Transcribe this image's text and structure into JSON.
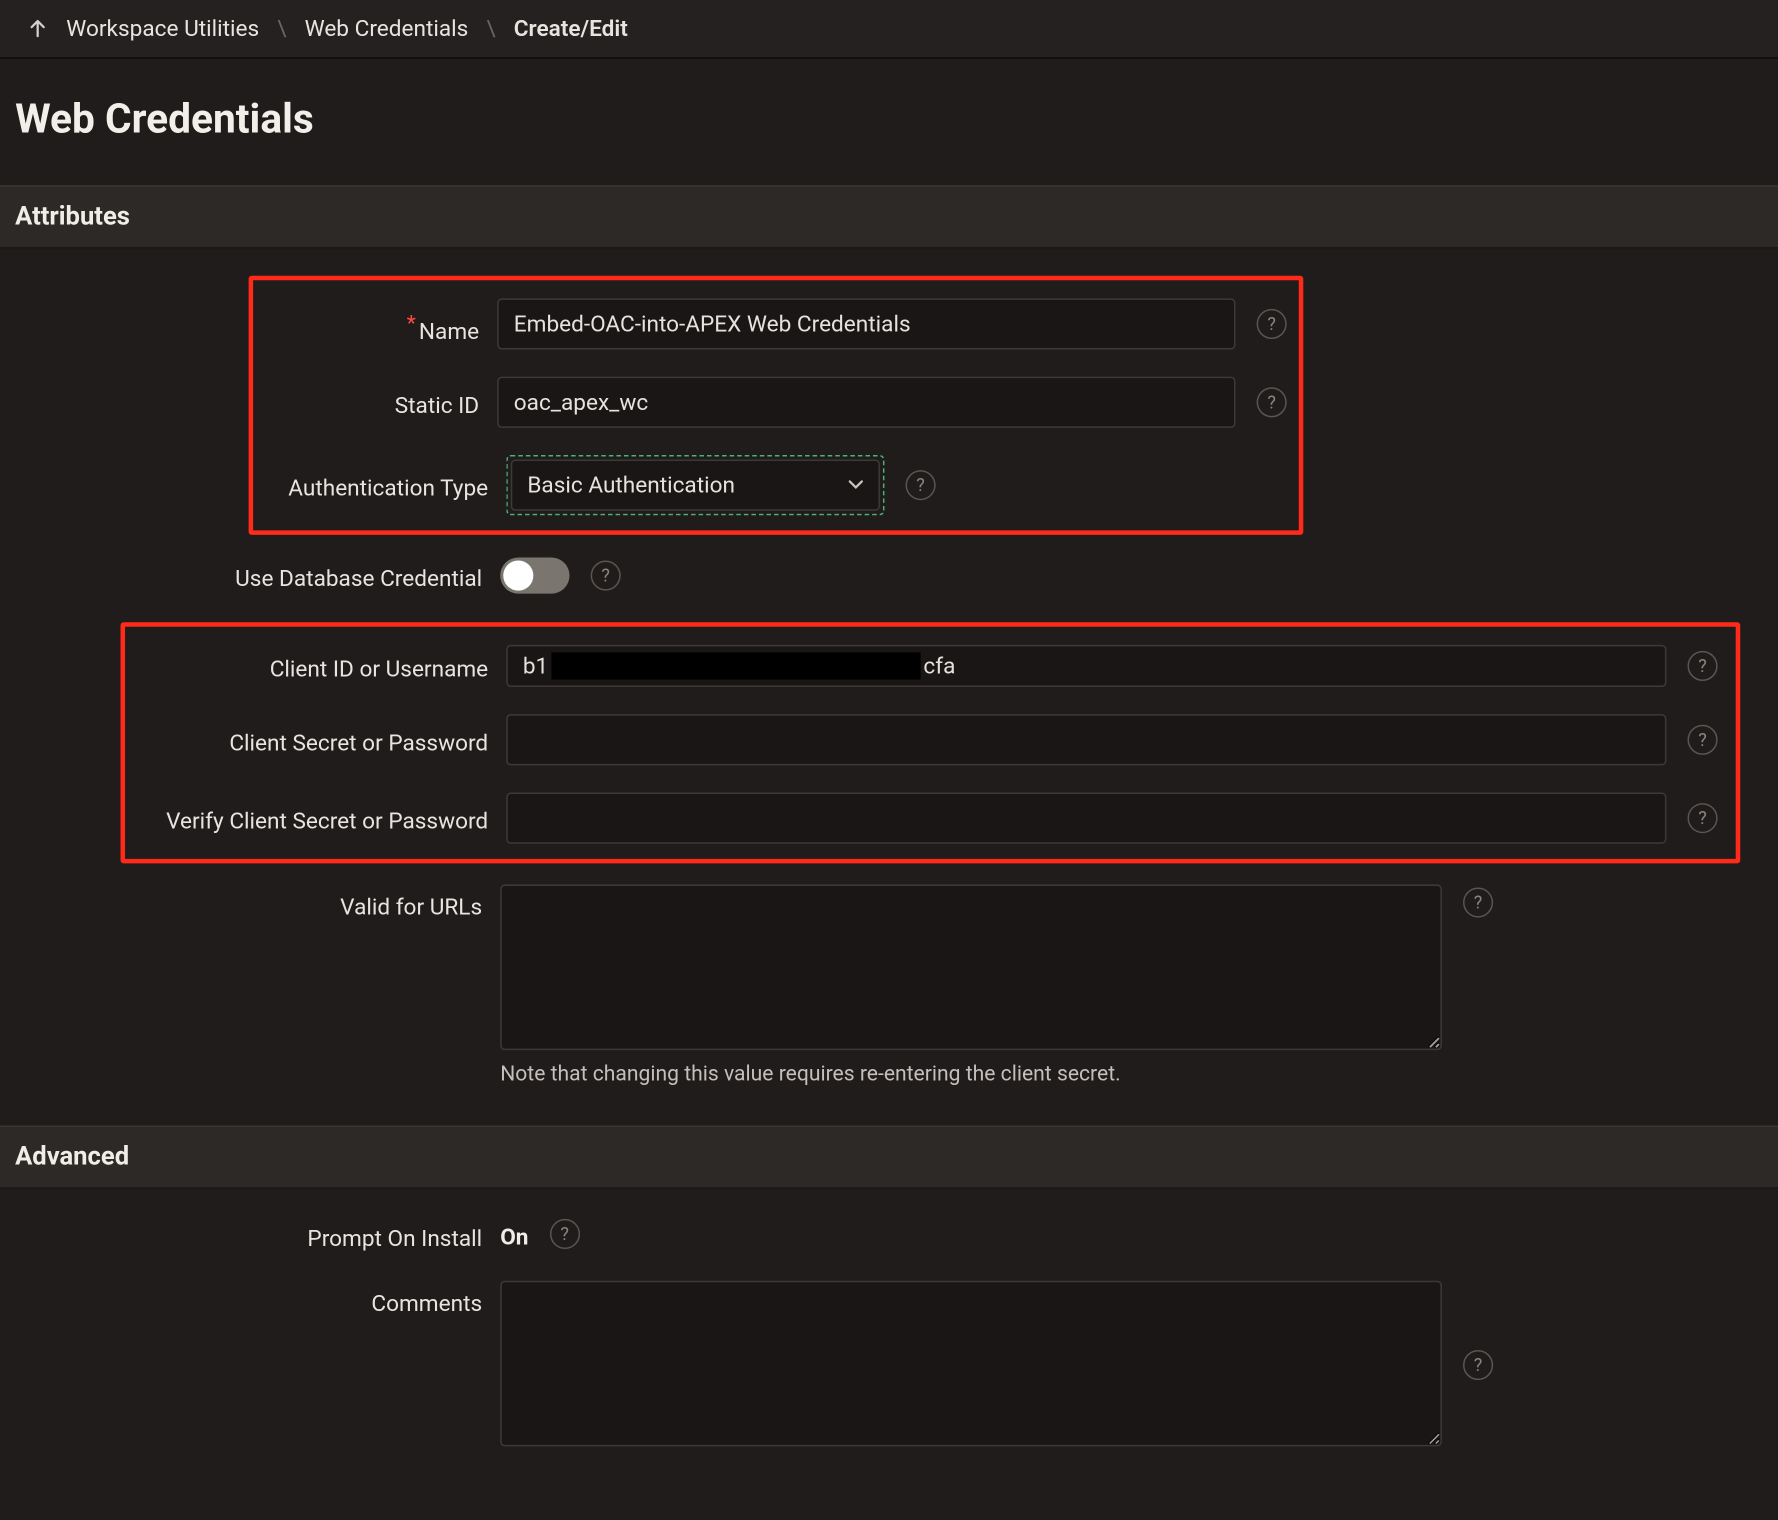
{
  "breadcrumb": {
    "items": [
      {
        "label": "Workspace Utilities"
      },
      {
        "label": "Web Credentials"
      }
    ],
    "current": "Create/Edit"
  },
  "page_title": "Web Credentials",
  "sections": {
    "attributes": {
      "header": "Attributes",
      "fields": {
        "name": {
          "label": "Name",
          "value": "Embed-OAC-into-APEX Web Credentials",
          "required": true
        },
        "static_id": {
          "label": "Static ID",
          "value": "oac_apex_wc"
        },
        "auth_type": {
          "label": "Authentication Type",
          "value": "Basic Authentication"
        },
        "use_db_cred": {
          "label": "Use Database Credential",
          "value": false
        },
        "client_id": {
          "label": "Client ID or Username",
          "prefix": "b1",
          "suffix": "cfa"
        },
        "client_secret": {
          "label": "Client Secret or Password",
          "value": ""
        },
        "verify_secret": {
          "label": "Verify Client Secret or Password",
          "value": ""
        },
        "valid_urls": {
          "label": "Valid for URLs",
          "value": "",
          "hint": "Note that changing this value requires re-entering the client secret."
        }
      }
    },
    "advanced": {
      "header": "Advanced",
      "fields": {
        "prompt_install": {
          "label": "Prompt On Install",
          "value": "On"
        },
        "comments": {
          "label": "Comments",
          "value": ""
        }
      }
    }
  }
}
